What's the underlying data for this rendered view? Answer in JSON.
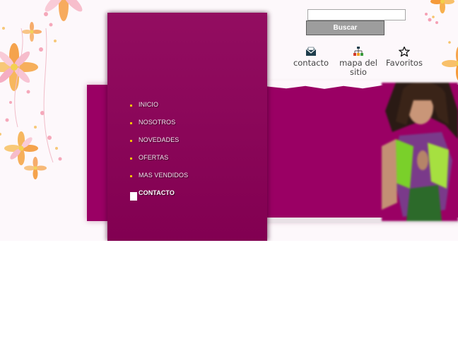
{
  "search": {
    "placeholder": "",
    "value": "",
    "button_label": "Buscar"
  },
  "top_links": [
    {
      "label": "contacto",
      "icon": "envelope-icon"
    },
    {
      "label": "mapa del sitio",
      "icon": "sitemap-icon"
    },
    {
      "label": "Favoritos",
      "icon": "star-icon"
    }
  ],
  "nav": {
    "items": [
      {
        "label": "INICIO"
      },
      {
        "label": "NOSOTROS"
      },
      {
        "label": "NOVEDADES"
      },
      {
        "label": "OFERTAS"
      },
      {
        "label": "MAS VENDIDOS"
      },
      {
        "label": "CONTACTO",
        "active": true
      }
    ]
  },
  "colors": {
    "panel": "#8d0058",
    "band": "#9a0064",
    "bullet": "#f2c200",
    "flower_orange": "#f59a3a",
    "flower_pink": "#f7b3c6"
  }
}
